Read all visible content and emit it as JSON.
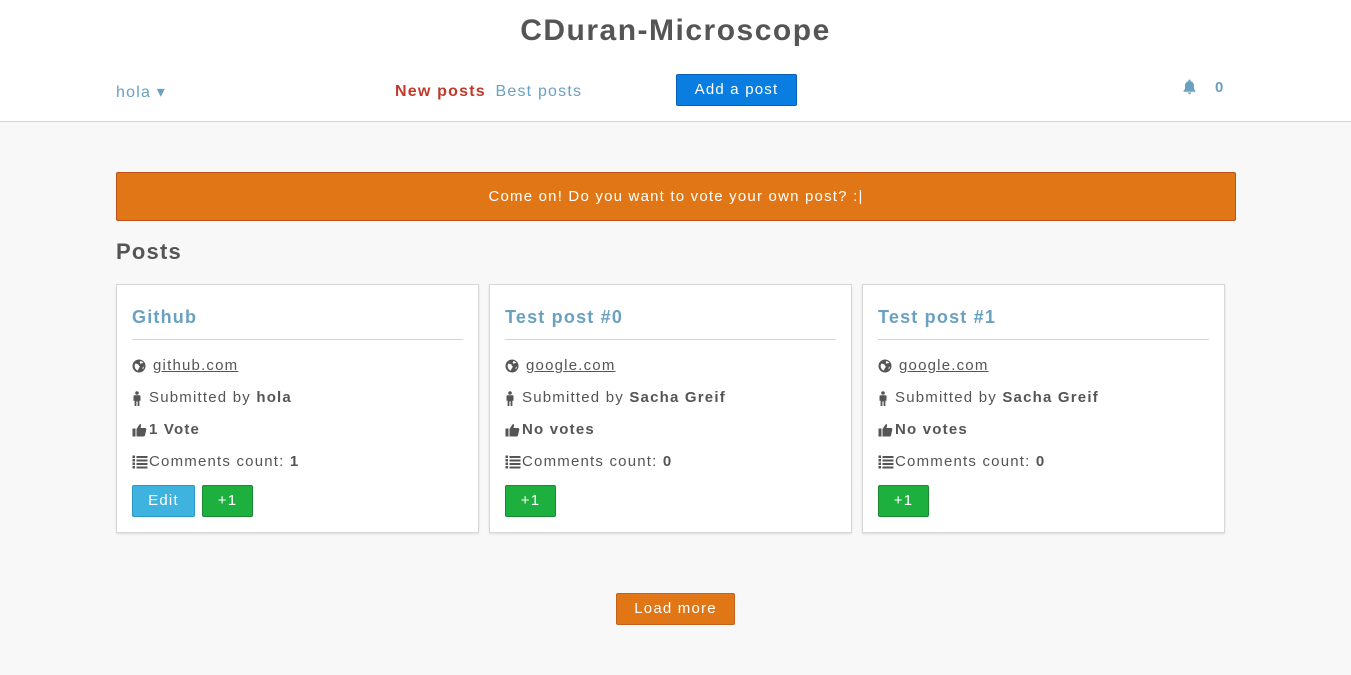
{
  "header": {
    "title": "CDuran-Microscope",
    "user_menu_label": "hola ▾",
    "nav": {
      "new_posts": "New posts",
      "best_posts": "Best posts"
    },
    "add_post_label": "Add a post",
    "notifications": {
      "icon": "bell-icon",
      "count": "0"
    }
  },
  "alert": {
    "message": "Come on! Do you want to vote your own post? :|"
  },
  "posts_heading": "Posts",
  "posts": [
    {
      "title": "Github",
      "domain": "github.com",
      "submitted_by_label": "Submitted by",
      "author": "hola",
      "votes": "1 Vote",
      "comments_label": "Comments count:",
      "comments_count": "1",
      "edit_label": "Edit",
      "upvote_label": "+1"
    },
    {
      "title": "Test post #0",
      "domain": "google.com",
      "submitted_by_label": "Submitted by",
      "author": "Sacha Greif",
      "votes": "No votes",
      "comments_label": "Comments count:",
      "comments_count": "0",
      "upvote_label": "+1"
    },
    {
      "title": "Test post #1",
      "domain": "google.com",
      "submitted_by_label": "Submitted by",
      "author": "Sacha Greif",
      "votes": "No votes",
      "comments_label": "Comments count:",
      "comments_count": "0",
      "upvote_label": "+1"
    }
  ],
  "load_more_label": "Load more",
  "colors": {
    "accent_blue": "#0a7ee0",
    "link_blue": "#6aa0c0",
    "active_red": "#c0392b",
    "alert_orange": "#e07616",
    "edit_blue": "#3fb3e0",
    "upvote_green": "#1eb03e"
  }
}
